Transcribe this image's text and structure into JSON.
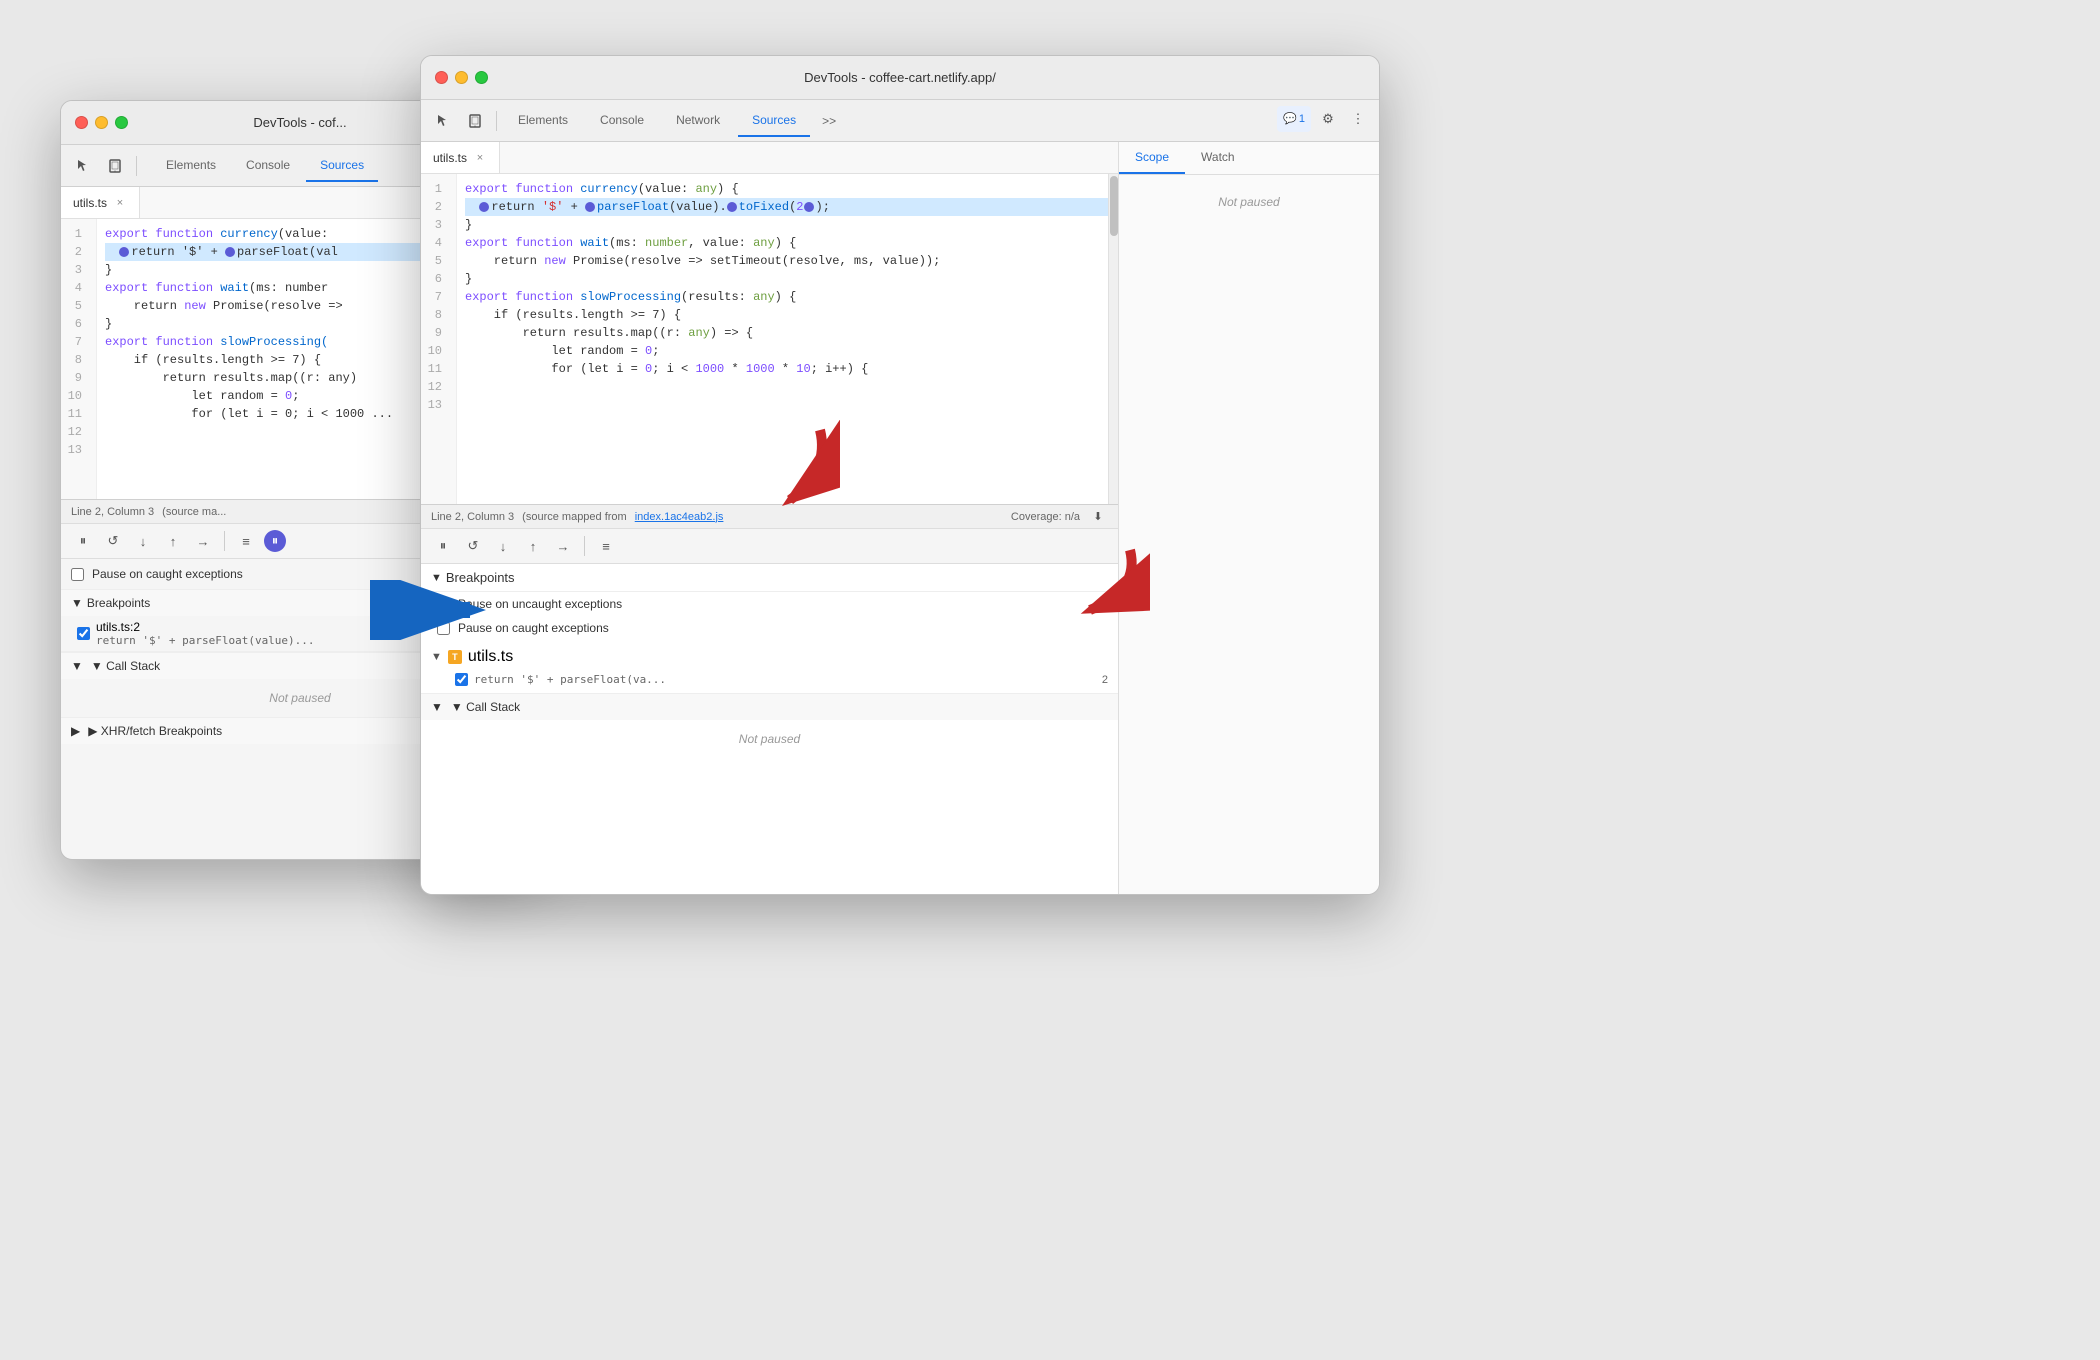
{
  "bg_window": {
    "title": "DevTools - cof...",
    "tabs": [
      "Elements",
      "Console",
      "Sources"
    ],
    "active_tab": "Sources",
    "file_tab": "utils.ts",
    "status_bar": "Line 2, Column 3",
    "status_source": "(source ma...",
    "code_lines": [
      {
        "num": 1,
        "text": "export function currency(value:"
      },
      {
        "num": 2,
        "text": "  ▶return '$' + ▶parseFloat(val",
        "highlight": true
      },
      {
        "num": 3,
        "text": "}"
      },
      {
        "num": 4,
        "text": ""
      },
      {
        "num": 5,
        "text": "export function wait(ms: number"
      },
      {
        "num": 6,
        "text": "    return new Promise(resolve =>"
      },
      {
        "num": 7,
        "text": "}"
      },
      {
        "num": 8,
        "text": ""
      },
      {
        "num": 9,
        "text": "export function slowProcessing("
      },
      {
        "num": 10,
        "text": "    if (results.length >= 7) {"
      },
      {
        "num": 11,
        "text": "        return results.map((r: any)"
      },
      {
        "num": 12,
        "text": "            let random = 0;"
      },
      {
        "num": 13,
        "text": "            for (let i = 0; i < 1000 ..."
      }
    ],
    "panel": {
      "pause_caught": "Pause on caught exceptions",
      "breakpoints_header": "▼ Breakpoints",
      "bp_item": "utils.ts:2",
      "bp_line": "return '$' + parseFloat(value)...",
      "call_stack": "▼ Call Stack",
      "not_paused": "Not paused",
      "xhr": "▶ XHR/fetch Breakpoints"
    }
  },
  "fg_window": {
    "title": "DevTools - coffee-cart.netlify.app/",
    "tabs": [
      "Elements",
      "Console",
      "Network",
      "Sources"
    ],
    "active_tab": "Sources",
    "file_tab": "utils.ts",
    "status_bar": "Line 2, Column 3",
    "status_source": "(source mapped from",
    "status_link": "index.1ac4eab2.js",
    "status_coverage": "Coverage: n/a",
    "code_lines": [
      {
        "num": 1,
        "text_parts": [
          {
            "t": "export ",
            "cls": "kw"
          },
          {
            "t": "function ",
            "cls": "kw"
          },
          {
            "t": "currency",
            "cls": "fn"
          },
          {
            "t": "(value: ",
            "cls": "plain"
          },
          {
            "t": "any",
            "cls": "type"
          },
          {
            "t": ") {",
            "cls": "plain"
          }
        ]
      },
      {
        "num": 2,
        "highlight": true,
        "text_parts": [
          {
            "t": "  ▶return '$' + ▶parseFloat(value).▶toFixed(2▶);",
            "cls": "plain"
          }
        ]
      },
      {
        "num": 3,
        "text_parts": [
          {
            "t": "}",
            "cls": "plain"
          }
        ]
      },
      {
        "num": 4,
        "text_parts": [
          {
            "t": "",
            "cls": "plain"
          }
        ]
      },
      {
        "num": 5,
        "text_parts": [
          {
            "t": "export ",
            "cls": "kw"
          },
          {
            "t": "function ",
            "cls": "kw"
          },
          {
            "t": "wait",
            "cls": "fn"
          },
          {
            "t": "(ms: ",
            "cls": "plain"
          },
          {
            "t": "number",
            "cls": "type"
          },
          {
            "t": ", value: ",
            "cls": "plain"
          },
          {
            "t": "any",
            "cls": "type"
          },
          {
            "t": ") {",
            "cls": "plain"
          }
        ]
      },
      {
        "num": 6,
        "text_parts": [
          {
            "t": "    return ",
            "cls": "plain"
          },
          {
            "t": "new ",
            "cls": "kw"
          },
          {
            "t": "Promise(resolve => setTimeout(resolve, ms, value));",
            "cls": "plain"
          }
        ]
      },
      {
        "num": 7,
        "text_parts": [
          {
            "t": "}",
            "cls": "plain"
          }
        ]
      },
      {
        "num": 8,
        "text_parts": [
          {
            "t": "",
            "cls": "plain"
          }
        ]
      },
      {
        "num": 9,
        "text_parts": [
          {
            "t": "export ",
            "cls": "kw"
          },
          {
            "t": "function ",
            "cls": "kw"
          },
          {
            "t": "slowProcessing",
            "cls": "fn"
          },
          {
            "t": "(results: ",
            "cls": "plain"
          },
          {
            "t": "any",
            "cls": "type"
          },
          {
            "t": ") {",
            "cls": "plain"
          }
        ]
      },
      {
        "num": 10,
        "text_parts": [
          {
            "t": "    if (results.length >= 7) {",
            "cls": "plain"
          }
        ]
      },
      {
        "num": 11,
        "text_parts": [
          {
            "t": "        return results.map((r: ",
            "cls": "plain"
          },
          {
            "t": "any",
            "cls": "type"
          },
          {
            "t": ") => {",
            "cls": "plain"
          }
        ]
      },
      {
        "num": 12,
        "text_parts": [
          {
            "t": "            let random = ",
            "cls": "plain"
          },
          {
            "t": "0",
            "cls": "num"
          },
          {
            "t": ";",
            "cls": "plain"
          }
        ]
      },
      {
        "num": 13,
        "text_parts": [
          {
            "t": "            for (let i = ",
            "cls": "plain"
          },
          {
            "t": "0",
            "cls": "num"
          },
          {
            "t": "; i < ",
            "cls": "plain"
          },
          {
            "t": "1000",
            "cls": "num"
          },
          {
            "t": " * ",
            "cls": "plain"
          },
          {
            "t": "1000",
            "cls": "num"
          },
          {
            "t": " * ",
            "cls": "plain"
          },
          {
            "t": "10",
            "cls": "num"
          },
          {
            "t": "; i++) {",
            "cls": "plain"
          }
        ]
      }
    ],
    "breakpoints_panel": {
      "header": "Breakpoints",
      "pause_uncaught": "Pause on uncaught exceptions",
      "pause_caught": "Pause on caught exceptions",
      "filename": "utils.ts",
      "bp_line": "return '$' + parseFloat(va...",
      "bp_line_num": "2",
      "call_stack": "▼ Call Stack",
      "not_paused": "Not paused"
    },
    "scope_panel": {
      "tabs": [
        "Scope",
        "Watch"
      ],
      "active_tab": "Scope",
      "not_paused": "Not paused"
    }
  },
  "arrows": {
    "red1_label": "red arrow top-right",
    "red2_label": "red arrow middle",
    "blue_label": "blue arrow pointing right"
  }
}
